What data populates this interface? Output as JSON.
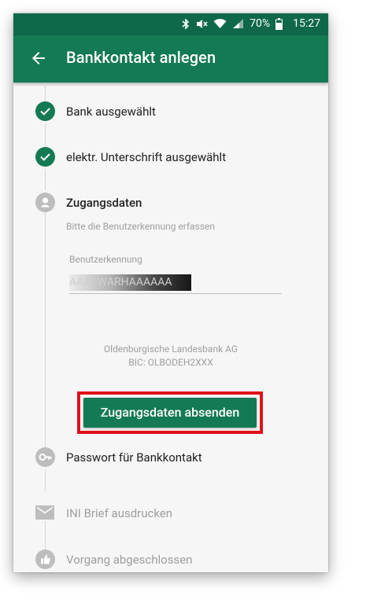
{
  "status": {
    "battery": "70%",
    "time": "15:27"
  },
  "appbar": {
    "title": "Bankkontakt anlegen"
  },
  "steps": {
    "bank": "Bank ausgewählt",
    "signature": "elektr. Unterschrift ausgewählt",
    "access": "Zugangsdaten",
    "password": "Passwort für Bankkontakt",
    "ini": "INI Brief ausdrucken",
    "done": "Vorgang abgeschlossen"
  },
  "access_form": {
    "hint": "Bitte die Benutzerkennung erfassen",
    "field_label": "Benutzerkennung",
    "field_value": "AAASWARHAAAAAA",
    "bank_name": "Oldenburgische Landesbank AG",
    "bic": "BIC: OLBODEH2XXX",
    "submit_label": "Zugangsdaten absenden"
  },
  "colors": {
    "primary": "#147a54",
    "statusbar": "#10684b",
    "highlight": "#e01019"
  }
}
